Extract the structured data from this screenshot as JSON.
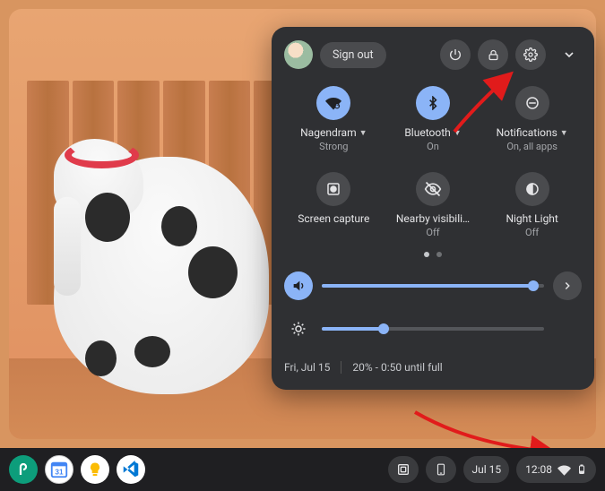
{
  "panel": {
    "signout_label": "Sign out",
    "tiles": [
      {
        "label": "Nagendram",
        "status": "Strong",
        "dropdown": true
      },
      {
        "label": "Bluetooth",
        "status": "On",
        "dropdown": true
      },
      {
        "label": "Notifications",
        "status": "On, all apps",
        "dropdown": true
      },
      {
        "label": "Screen capture",
        "status": "",
        "dropdown": false
      },
      {
        "label": "Nearby visibili…",
        "status": "Off",
        "dropdown": false
      },
      {
        "label": "Night Light",
        "status": "Off",
        "dropdown": false
      }
    ],
    "sliders": {
      "volume_percent": 95,
      "brightness_percent": 28
    },
    "footer": {
      "date": "Fri, Jul 15",
      "battery": "20% - 0:50 until full"
    }
  },
  "shelf": {
    "date": "Jul 15",
    "clock": "12:08"
  },
  "colors": {
    "accent": "#8bb4f7",
    "panel_bg": "#2f3033"
  }
}
